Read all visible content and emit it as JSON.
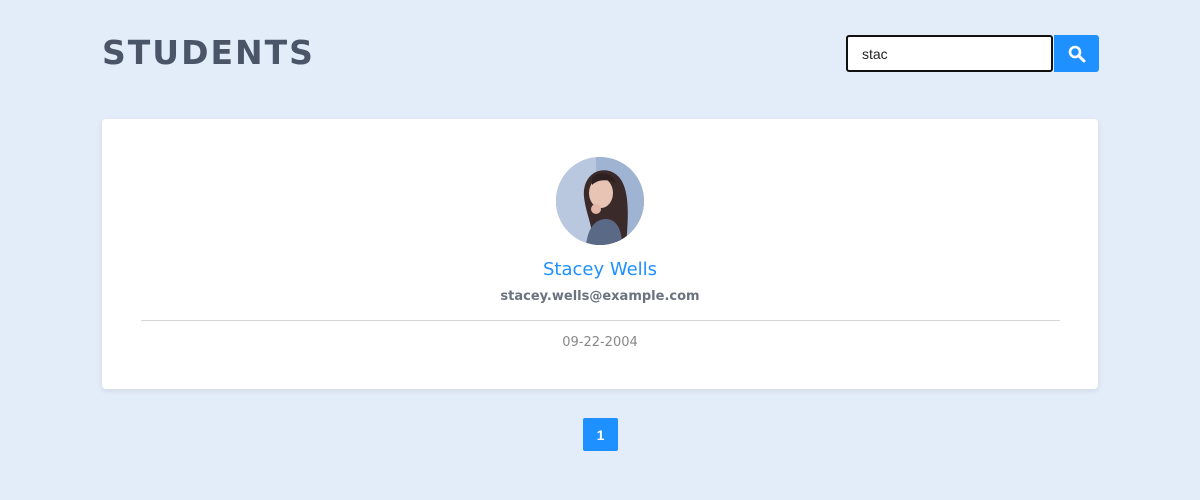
{
  "header": {
    "title": "STUDENTS"
  },
  "search": {
    "value": "stac",
    "icon": "search-icon"
  },
  "student": {
    "name": "Stacey Wells",
    "email": "stacey.wells@example.com",
    "dob": "09-22-2004",
    "avatar": "avatar-photo"
  },
  "pagination": {
    "pages": [
      "1"
    ],
    "current": "1"
  },
  "colors": {
    "background": "#e3ecf9",
    "accent": "#1e90ff",
    "title": "#4a5568",
    "card": "#ffffff"
  }
}
